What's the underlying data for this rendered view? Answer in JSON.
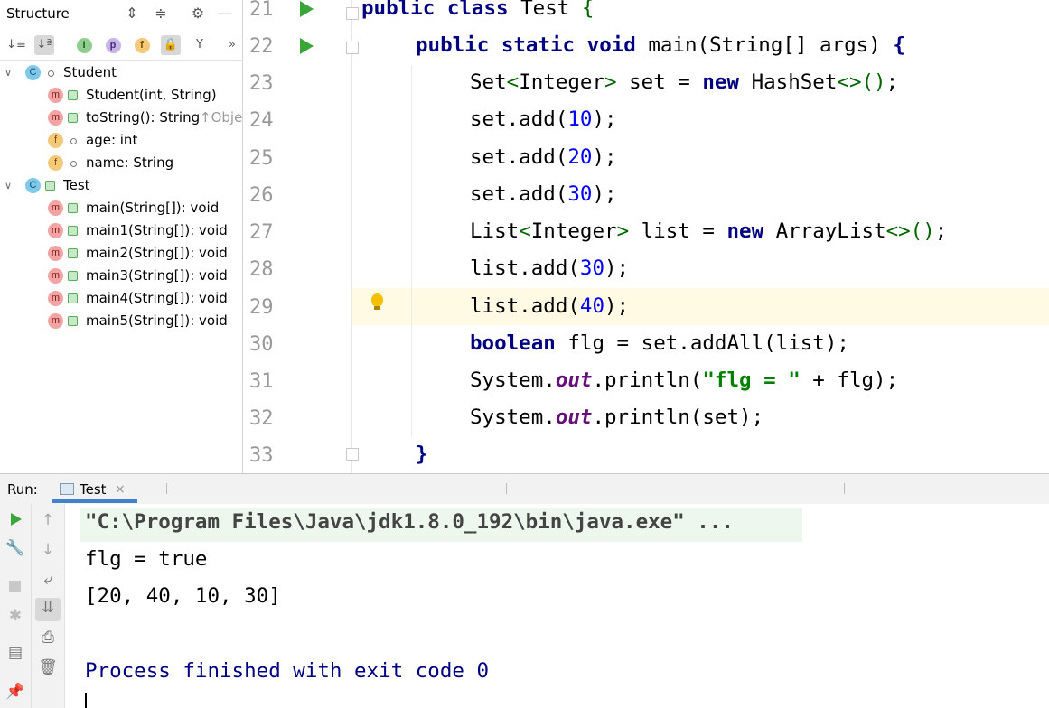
{
  "structure": {
    "title": "Structure",
    "tree": [
      {
        "label": "Student",
        "icon": "class-icon",
        "level": 0,
        "expanded": true
      },
      {
        "label": "Student(int, String)",
        "icon": "method-icon",
        "level": 1
      },
      {
        "label": "toString(): String",
        "suffix": "↑Objec",
        "icon": "method-icon",
        "level": 1
      },
      {
        "label": "age: int",
        "icon": "field-icon",
        "level": 1
      },
      {
        "label": "name: String",
        "icon": "field-icon",
        "level": 1
      },
      {
        "label": "Test",
        "icon": "class-icon",
        "level": 0,
        "expanded": true
      },
      {
        "label": "main(String[]): void",
        "icon": "method-icon",
        "level": 1
      },
      {
        "label": "main1(String[]): void",
        "icon": "method-icon",
        "level": 1
      },
      {
        "label": "main2(String[]): void",
        "icon": "method-icon",
        "level": 1
      },
      {
        "label": "main3(String[]): void",
        "icon": "method-icon",
        "level": 1
      },
      {
        "label": "main4(String[]): void",
        "icon": "method-icon",
        "level": 1
      },
      {
        "label": "main5(String[]): void",
        "icon": "method-icon",
        "level": 1
      }
    ]
  },
  "editor": {
    "line_numbers": [
      "21",
      "22",
      "23",
      "24",
      "25",
      "26",
      "27",
      "28",
      "29",
      "30",
      "31",
      "32",
      "33"
    ],
    "current_line": "29",
    "lines": {
      "l21": {
        "kw1": "public",
        "kw2": "class",
        "rest": " Test ",
        "brace": "{"
      },
      "l22": {
        "kw1": "public",
        "kw2": "static",
        "kw3": "void",
        "rest": " main(String[] args) ",
        "brace": "{"
      },
      "l23": {
        "a": "Set",
        "b": "<",
        "c": "Integer",
        "d": ">",
        "e": " set = ",
        "kw": "new",
        "f": " HashSet",
        "g": "<>()",
        "h": ";"
      },
      "l24": {
        "a": "set.add(",
        "num": "10",
        "b": ");"
      },
      "l25": {
        "a": "set.add(",
        "num": "20",
        "b": ");"
      },
      "l26": {
        "a": "set.add(",
        "num": "30",
        "b": ");"
      },
      "l27": {
        "a": "List",
        "b": "<",
        "c": "Integer",
        "d": ">",
        "e": " list = ",
        "kw": "new",
        "f": " ArrayList",
        "g": "<>()",
        "h": ";"
      },
      "l28": {
        "a": "list.add(",
        "num": "30",
        "b": ");"
      },
      "l29": {
        "a": "list.add(",
        "num": "40",
        "b": ");"
      },
      "l30": {
        "kw": "boolean",
        "a": " flg = set.addAll(list);"
      },
      "l31": {
        "a": "System.",
        "fld": "out",
        "b": ".println(",
        "str": "\"flg = \"",
        "c": " + flg);"
      },
      "l32": {
        "a": "System.",
        "fld": "out",
        "b": ".println(set);"
      },
      "l33": {
        "brace": "}"
      }
    }
  },
  "run": {
    "label": "Run:",
    "tab": "Test",
    "tab_close": "×",
    "console": [
      "\"C:\\Program Files\\Java\\jdk1.8.0_192\\bin\\java.exe\" ...",
      "flg = true",
      "[20, 40, 10, 30]",
      "",
      "Process finished with exit code 0"
    ]
  },
  "colors": {
    "keyword": "#000080",
    "number": "#0000ff",
    "string": "#008000",
    "static_field": "#660e7a",
    "run_green": "#3aa63a",
    "current_line_bg": "#fffae3",
    "tab_underline": "#4083c9"
  }
}
